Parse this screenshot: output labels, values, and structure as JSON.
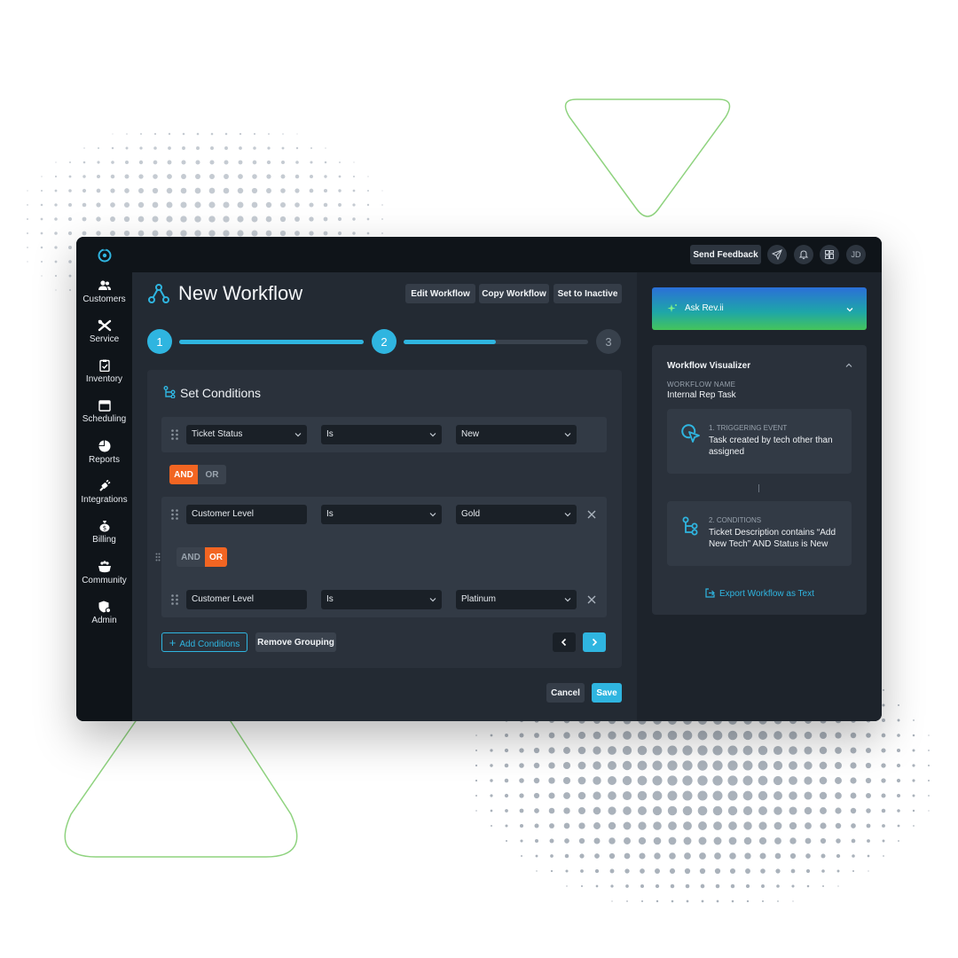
{
  "topbar": {
    "feedback_label": "Send Feedback",
    "avatar_initials": "JD"
  },
  "sidebar": {
    "items": [
      {
        "label": "Customers",
        "icon": "users-icon"
      },
      {
        "label": "Service",
        "icon": "tools-icon"
      },
      {
        "label": "Inventory",
        "icon": "clipboard-check-icon"
      },
      {
        "label": "Scheduling",
        "icon": "calendar-icon"
      },
      {
        "label": "Reports",
        "icon": "pie-chart-icon"
      },
      {
        "label": "Integrations",
        "icon": "plug-icon"
      },
      {
        "label": "Billing",
        "icon": "money-bag-icon"
      },
      {
        "label": "Community",
        "icon": "community-icon"
      },
      {
        "label": "Admin",
        "icon": "admin-shield-icon"
      }
    ]
  },
  "header": {
    "title": "New Workflow",
    "edit_label": "Edit Workflow",
    "copy_label": "Copy Workflow",
    "inactive_label": "Set to Inactive"
  },
  "stepper": {
    "steps": [
      "1",
      "2",
      "3"
    ],
    "current_step": 2,
    "progress_segment_2": 0.5
  },
  "conditions": {
    "title": "Set Conditions",
    "rows": [
      {
        "field": "Ticket Status",
        "operator": "Is",
        "value": "New"
      },
      {
        "field": "Customer Level",
        "operator": "Is",
        "value": "Gold"
      },
      {
        "field": "Customer Level",
        "operator": "Is",
        "value": "Platinum"
      }
    ],
    "outer_and": "AND",
    "outer_or": "OR",
    "outer_selected": "AND",
    "inner_and": "AND",
    "inner_or": "OR",
    "inner_selected": "OR",
    "add_label": "Add Conditions",
    "remove_grouping_label": "Remove Grouping"
  },
  "footer": {
    "cancel_label": "Cancel",
    "save_label": "Save"
  },
  "ask": {
    "label": "Ask Rev.ii"
  },
  "visualizer": {
    "title": "Workflow Visualizer",
    "name_label": "WORKFLOW NAME",
    "name_value": "Internal Rep Task",
    "steps": [
      {
        "label": "1. TRIGGERING EVENT",
        "text": "Task created by tech other than assigned"
      },
      {
        "label": "2. CONDITIONS",
        "text": "Ticket Description contains “Add New Tech” AND Status is New"
      }
    ],
    "export_label": "Export Workflow as Text"
  },
  "colors": {
    "accent": "#2fb5e0",
    "toggle_active": "#f26522",
    "decor_green": "#8fd37f",
    "dots": "#b5bcc4"
  }
}
